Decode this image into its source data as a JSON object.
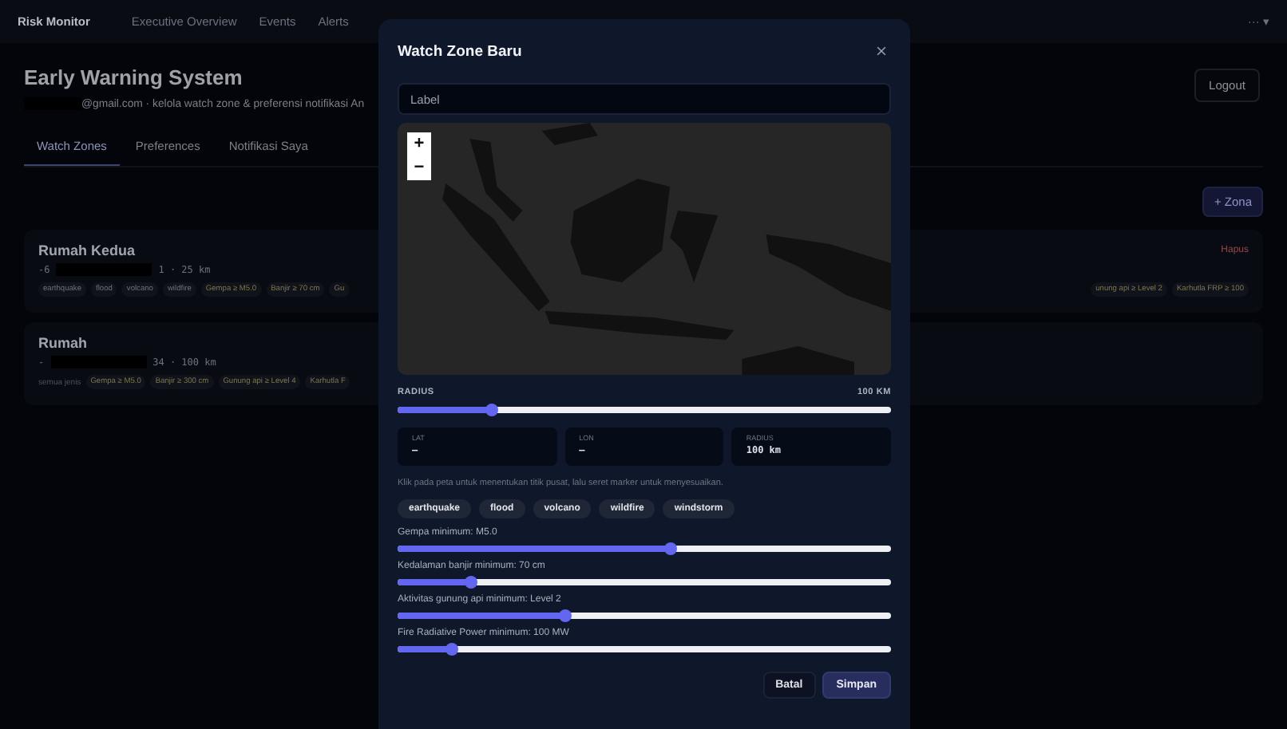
{
  "topbar": {
    "brand": "Risk Monitor",
    "nav": [
      {
        "label": "Executive Overview"
      },
      {
        "label": "Events"
      },
      {
        "label": "Alerts"
      }
    ],
    "menu": "··· ▾"
  },
  "header": {
    "title": "Early Warning System",
    "subtitle": "@gmail.com · kelola watch zone & preferensi notifikasi An",
    "logout": "Logout"
  },
  "tabs": [
    {
      "label": "Watch Zones",
      "selected": true
    },
    {
      "label": "Preferences",
      "selected": false
    },
    {
      "label": "Notifikasi Saya",
      "selected": false
    }
  ],
  "add_zone": "+ Zona",
  "zones": [
    {
      "name": "Rumah Kedua",
      "coords_start": "-6",
      "coords_end": "1 · 25 km",
      "left_tags": [
        {
          "text": "earthquake",
          "kind": "type"
        },
        {
          "text": "flood",
          "kind": "type"
        },
        {
          "text": "volcano",
          "kind": "type"
        },
        {
          "text": "wildfire",
          "kind": "type"
        },
        {
          "text": "Gempa ≥ M5.0",
          "kind": "threshold"
        },
        {
          "text": "Banjir ≥ 70 cm",
          "kind": "threshold"
        },
        {
          "text": "Gu",
          "kind": "threshold"
        }
      ],
      "right_tags": [
        {
          "text": "unung api ≥ Level 2",
          "kind": "threshold"
        },
        {
          "text": "Karhutla FRP ≥ 100",
          "kind": "threshold"
        }
      ],
      "delete": "Hapus"
    },
    {
      "name": "Rumah",
      "coords_start": "-",
      "coords_end": "34 · 100 km",
      "left_tags": [
        {
          "text": "semua jenis",
          "kind": "note"
        },
        {
          "text": "Gempa ≥ M5.0",
          "kind": "threshold"
        },
        {
          "text": "Banjir ≥ 300 cm",
          "kind": "threshold"
        },
        {
          "text": "Gunung api ≥ Level 4",
          "kind": "threshold"
        },
        {
          "text": "Karhutla F",
          "kind": "threshold"
        }
      ]
    }
  ],
  "modal": {
    "title": "Watch Zone Baru",
    "label_placeholder": "Label",
    "zoom_in": "+",
    "zoom_out": "−",
    "radius": {
      "label": "RADIUS",
      "reading": "100 KM",
      "level": 0.19
    },
    "fields": [
      {
        "label": "LAT",
        "value": "—"
      },
      {
        "label": "LON",
        "value": "—"
      },
      {
        "label": "RADIUS",
        "value": "100 km"
      }
    ],
    "hint": "Klik pada peta untuk menentukan titik pusat, lalu seret marker untuk menyesuaikan.",
    "chips": [
      "earthquake",
      "flood",
      "volcano",
      "wildfire",
      "windstorm"
    ],
    "thresholds": [
      {
        "label": "Gempa minimum: M5.0",
        "level": 0.555
      },
      {
        "label": "Kedalaman banjir minimum: 70 cm",
        "level": 0.15
      },
      {
        "label": "Aktivitas gunung api minimum: Level 2",
        "level": 0.34
      },
      {
        "label": "Fire Radiative Power minimum: 100 MW",
        "level": 0.11
      }
    ],
    "cancel": "Batal",
    "save": "Simpan"
  }
}
